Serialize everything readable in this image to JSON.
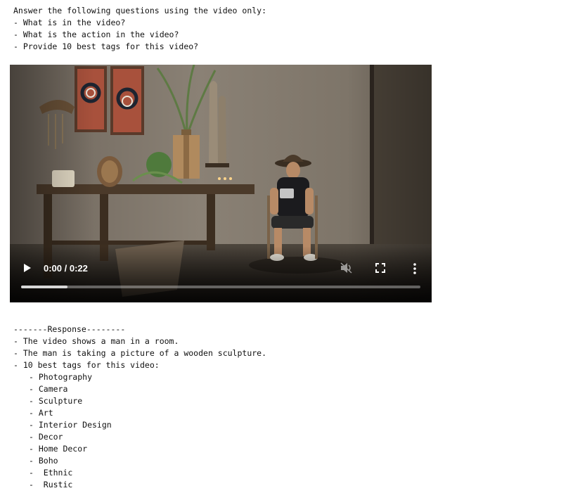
{
  "prompt": {
    "lines": [
      "Answer the following questions using the video only:",
      "- What is in the video?",
      "- What is the action in the video?",
      "- Provide 10 best tags for this video?"
    ]
  },
  "video": {
    "time_display": "0:00 / 0:22",
    "buffered_fraction": 0.116,
    "icons": {
      "play": "play-icon",
      "mute": "volume-muted-icon",
      "fullscreen": "fullscreen-icon",
      "more": "more-vertical-icon"
    }
  },
  "response": {
    "header": "-------Response--------",
    "lines": [
      "- The video shows a man in a room.",
      "- The man is taking a picture of a wooden sculpture.",
      "- 10 best tags for this video:"
    ],
    "tags": [
      "- Photography",
      "- Camera",
      "- Sculpture",
      "- Art",
      "- Interior Design",
      "- Decor",
      "- Home Decor",
      "- Boho",
      "-  Ethnic",
      "-  Rustic"
    ]
  }
}
